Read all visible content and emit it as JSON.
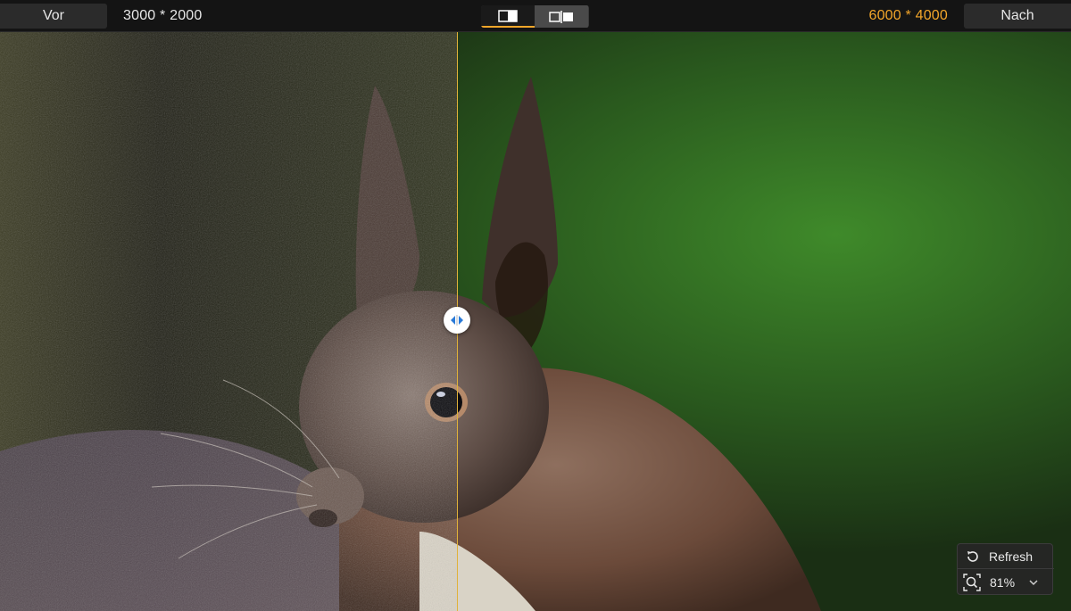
{
  "toolbar": {
    "before_label": "Vor",
    "after_label": "Nach",
    "before_dimensions": "3000 * 2000",
    "after_dimensions": "6000 * 4000",
    "view_modes": [
      {
        "name": "split-view",
        "active": true
      },
      {
        "name": "side-by-side-view",
        "active": false
      }
    ]
  },
  "controls": {
    "refresh_label": "Refresh",
    "zoom_level": "81%"
  },
  "compare": {
    "divider_position": 0.427
  },
  "colors": {
    "accent": "#f3a62a",
    "divider": "#e0b23a"
  }
}
